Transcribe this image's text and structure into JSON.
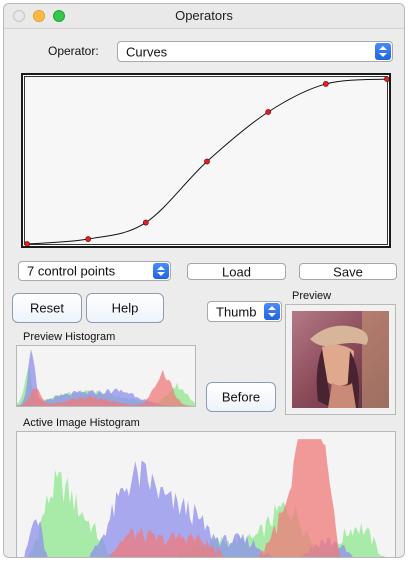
{
  "window": {
    "title": "Operators"
  },
  "operator": {
    "label": "Operator:",
    "selected": "Curves"
  },
  "curve": {
    "points": [
      [
        0.0,
        0.0
      ],
      [
        0.17,
        0.03
      ],
      [
        0.33,
        0.13
      ],
      [
        0.5,
        0.5
      ],
      [
        0.67,
        0.8
      ],
      [
        0.83,
        0.97
      ],
      [
        1.0,
        1.0
      ]
    ]
  },
  "points_select": {
    "selected": "7 control points"
  },
  "buttons": {
    "load": "Load",
    "save": "Save",
    "reset": "Reset",
    "help": "Help",
    "before": "Before"
  },
  "thumb_select": {
    "selected": "Thumb"
  },
  "preview": {
    "label": "Preview"
  },
  "preview_histogram": {
    "label": "Preview Histogram"
  },
  "active_histogram": {
    "label": "Active Image Histogram"
  },
  "colors": {
    "red": "#f07a7a",
    "green": "#8fe88f",
    "blue": "#8f8fee",
    "accent": "#1f63e0"
  }
}
